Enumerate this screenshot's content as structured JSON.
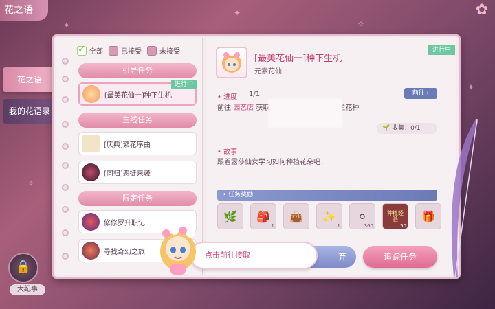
{
  "header": {
    "title": "花之语",
    "close_icon": "close-flower-icon"
  },
  "side_tabs": [
    {
      "label": "花之语",
      "active": true
    },
    {
      "label": "我的花语录",
      "active": false
    }
  ],
  "memo": {
    "label": "大纪事"
  },
  "filters": [
    {
      "label": "全部",
      "checked": true
    },
    {
      "label": "已接受",
      "checked": false
    },
    {
      "label": "未接受",
      "checked": false
    }
  ],
  "sections": {
    "guide": "引导任务",
    "main": "主线任务",
    "limited": "限定任务"
  },
  "tasks": {
    "guide": [
      {
        "title": "[最美花仙一]种下生机",
        "badge": "进行中"
      }
    ],
    "main": [
      {
        "title": "[庆典]繁花序曲"
      },
      {
        "title": "[同归]恶徒来袭"
      }
    ],
    "limited": [
      {
        "title": "修修罗升职记"
      },
      {
        "title": "寻找奇幻之旅"
      }
    ]
  },
  "detail": {
    "title": "[最美花仙一]种下生机",
    "subtitle": "元素花仙",
    "status": "进行中",
    "progress_label": "进度",
    "progress_value": "1/1",
    "progress_desc_pre": "前往",
    "progress_desc_place": "园艺店",
    "progress_desc_post": "获取，并在家园种植白色铃兰花种",
    "goto_label": "前往",
    "collect_label": "收集：0/1",
    "story_label": "故事",
    "story_text": "跟着露莎仙女学习如何种植花朵吧！",
    "reward_label": "任务奖励",
    "rewards": [
      {
        "icon": "sprout-icon",
        "count": ""
      },
      {
        "icon": "seed-bag-icon",
        "count": "1"
      },
      {
        "icon": "green-bag-icon",
        "count": ""
      },
      {
        "icon": "sparkle-icon",
        "count": "1"
      },
      {
        "icon": "pearl-icon",
        "count": "360"
      },
      {
        "icon": "book-icon",
        "count": "50",
        "text": "种植经验"
      },
      {
        "icon": "gift-icon",
        "count": ""
      }
    ],
    "abandon_label": "弃",
    "track_label": "追踪任务"
  },
  "hint": {
    "text": "点击前往接取"
  }
}
